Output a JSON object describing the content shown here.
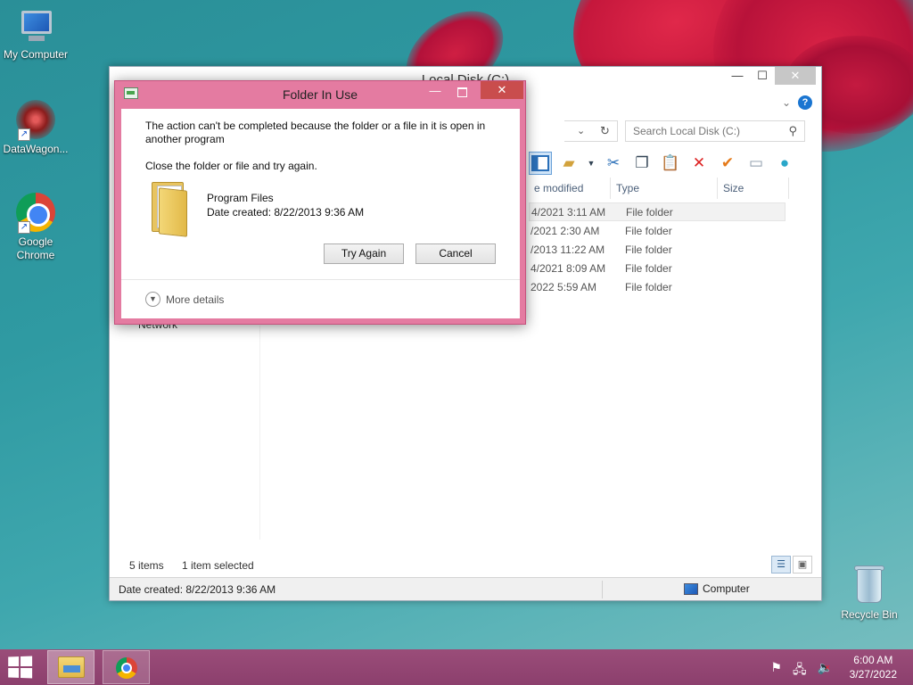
{
  "desktop": {
    "icons": [
      {
        "label": "My Computer",
        "icon": "computer-icon"
      },
      {
        "label": "DataWagon...",
        "icon": "datawagon-icon"
      },
      {
        "label": "Google Chrome",
        "icon": "chrome-icon"
      },
      {
        "label": "Recycle Bin",
        "icon": "recycle-bin-icon"
      }
    ]
  },
  "explorer": {
    "title": "Local Disk (C:)",
    "search_placeholder": "Search Local Disk (C:)",
    "columns": {
      "modified": "e modified",
      "type": "Type",
      "size": "Size"
    },
    "rows": [
      {
        "modified": "4/2021 3:11 AM",
        "type": "File folder"
      },
      {
        "modified": "/2021 2:30 AM",
        "type": "File folder"
      },
      {
        "modified": "/2013 11:22 AM",
        "type": "File folder"
      },
      {
        "modified": "4/2021 8:09 AM",
        "type": "File folder"
      },
      {
        "modified": "2022 5:59 AM",
        "type": "File folder"
      }
    ],
    "nav_network": "Network",
    "items_count": "5 items",
    "items_selected": "1 item selected",
    "status_left": "Date created: 8/22/2013 9:36 AM",
    "status_location": "Computer"
  },
  "dialog": {
    "title": "Folder In Use",
    "message": "The action can't be completed because the folder or a file in it is open in another program",
    "sub": "Close the folder or file and try again.",
    "file_name": "Program Files",
    "file_date": "Date created: 8/22/2013 9:36 AM",
    "try_again": "Try Again",
    "cancel": "Cancel",
    "more_details": "More details"
  },
  "taskbar": {
    "time": "6:00 AM",
    "date": "3/27/2022"
  },
  "colors": {
    "dialog_frame": "#e47ba1",
    "dialog_close": "#c94d4d",
    "taskbar": "#8c3f6d",
    "desktop": "#2f9aa2"
  }
}
